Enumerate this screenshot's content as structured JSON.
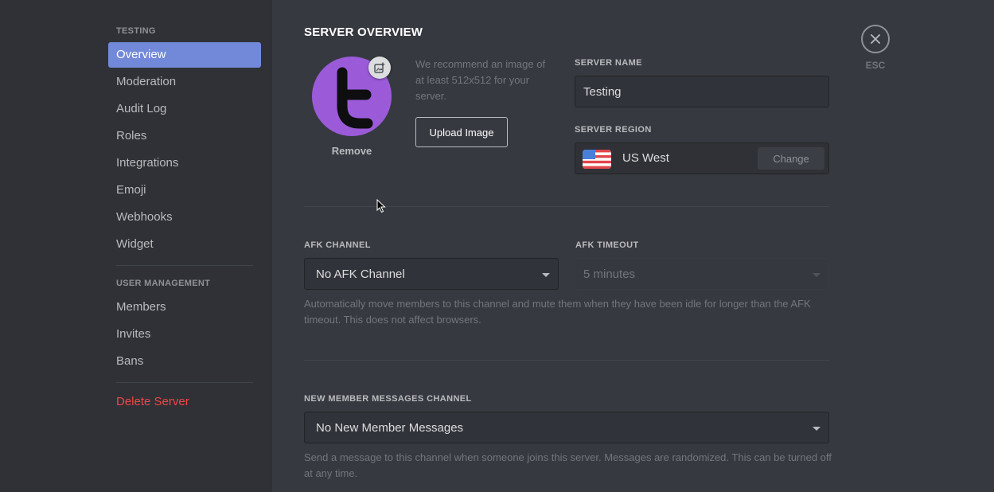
{
  "sidebar": {
    "server_header": "TESTING",
    "items": [
      {
        "label": "Overview",
        "active": true
      },
      {
        "label": "Moderation"
      },
      {
        "label": "Audit Log"
      },
      {
        "label": "Roles"
      },
      {
        "label": "Integrations"
      },
      {
        "label": "Emoji"
      },
      {
        "label": "Webhooks"
      },
      {
        "label": "Widget"
      }
    ],
    "user_management_header": "USER MANAGEMENT",
    "user_items": [
      {
        "label": "Members"
      },
      {
        "label": "Invites"
      },
      {
        "label": "Bans"
      }
    ],
    "delete_label": "Delete Server"
  },
  "main": {
    "title": "SERVER OVERVIEW",
    "icon": {
      "remove_label": "Remove",
      "recommend_text": "We recommend an image of at least 512x512 for your server.",
      "upload_label": "Upload Image",
      "edit_icon": "add-image-icon"
    },
    "server_name": {
      "label": "SERVER NAME",
      "value": "Testing"
    },
    "server_region": {
      "label": "SERVER REGION",
      "value": "US West",
      "flag": "us-flag",
      "change_label": "Change"
    },
    "afk_channel": {
      "label": "AFK CHANNEL",
      "value": "No AFK Channel"
    },
    "afk_timeout": {
      "label": "AFK TIMEOUT",
      "value": "5 minutes"
    },
    "afk_help": "Automatically move members to this channel and mute them when they have been idle for longer than the AFK timeout. This does not affect browsers.",
    "new_member": {
      "label": "NEW MEMBER MESSAGES CHANNEL",
      "value": "No New Member Messages",
      "help": "Send a message to this channel when someone joins this server. Messages are randomized. This can be turned off at any time."
    }
  },
  "close": {
    "icon": "close-icon",
    "label": "ESC"
  },
  "colors": {
    "background": "#36393f",
    "sidebar": "#2f3136",
    "accent": "#7289da",
    "danger": "#f04747",
    "avatar": "#9b5bd9"
  }
}
